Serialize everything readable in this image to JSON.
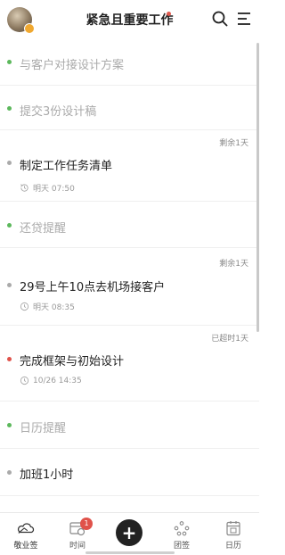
{
  "header": {
    "title": "紧急且重要工作",
    "avatar": "user-avatar",
    "search_icon": "search-icon",
    "menu_icon": "menu-icon"
  },
  "tasks": [
    {
      "name": "与客户对接设计方案",
      "done": true,
      "dot_color": "#5cb85c"
    },
    {
      "name": "提交3份设计稿",
      "done": true,
      "dot_color": "#5cb85c"
    },
    {
      "name": "制定工作任务清单",
      "done": false,
      "dot_color": "#aaaaaa",
      "remain": "剩余1天",
      "time": "明天 07:50",
      "time_icon": "repeat-clock-icon"
    },
    {
      "name": "还贷提醒",
      "done": true,
      "dot_color": "#5cb85c"
    },
    {
      "name": "29号上午10点去机场接客户",
      "done": false,
      "dot_color": "#aaaaaa",
      "remain": "剩余1天",
      "time": "明天 08:35",
      "time_icon": "clock-icon"
    },
    {
      "name": "完成框架与初始设计",
      "done": false,
      "dot_color": "#e0524a",
      "remain": "已超时1天",
      "time": "10/26 14:35",
      "time_icon": "clock-icon"
    },
    {
      "name": "日历提醒",
      "done": true,
      "dot_color": "#5cb85c"
    },
    {
      "name": "加班1小时",
      "done": false,
      "dot_color": "#aaaaaa"
    }
  ],
  "bottom_nav": {
    "items": [
      {
        "label": "敬业签",
        "icon": "cloud-icon"
      },
      {
        "label": "时间",
        "icon": "calendar-clock-icon",
        "badge": "1"
      },
      {
        "label": "团签",
        "icon": "team-icon"
      },
      {
        "label": "日历",
        "icon": "calendar-icon"
      }
    ],
    "add_label": "+"
  }
}
